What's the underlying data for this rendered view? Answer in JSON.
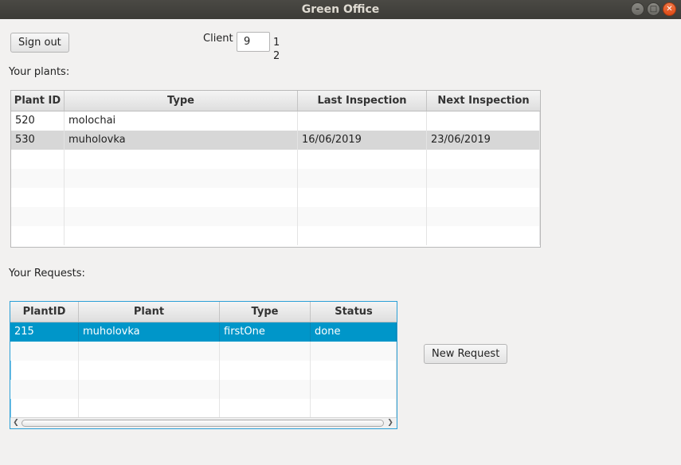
{
  "window": {
    "title": "Green Office"
  },
  "toolbar": {
    "sign_out_label": "Sign out",
    "client_label": "Client",
    "client_value": "9",
    "client_options": [
      "1",
      "2"
    ]
  },
  "plants": {
    "heading": "Your plants:",
    "columns": [
      "Plant ID",
      "Type",
      "Last Inspection",
      "Next Inspection"
    ],
    "rows": [
      [
        "520",
        "molochai",
        "",
        ""
      ],
      [
        "530",
        "muholovka",
        "16/06/2019",
        "23/06/2019"
      ]
    ],
    "selected_row": 1
  },
  "requests": {
    "heading": "Your Requests:",
    "columns": [
      "PlantID",
      "Plant",
      "Type",
      "Status"
    ],
    "rows": [
      [
        "215",
        "muholovka",
        "firstOne",
        "done"
      ]
    ],
    "selected_row": 0
  },
  "actions": {
    "new_request_label": "New Request"
  },
  "colors": {
    "selection_blue": "#0096c9",
    "selection_gray": "#d7d7d7",
    "titlebar": "#3c3b37"
  }
}
